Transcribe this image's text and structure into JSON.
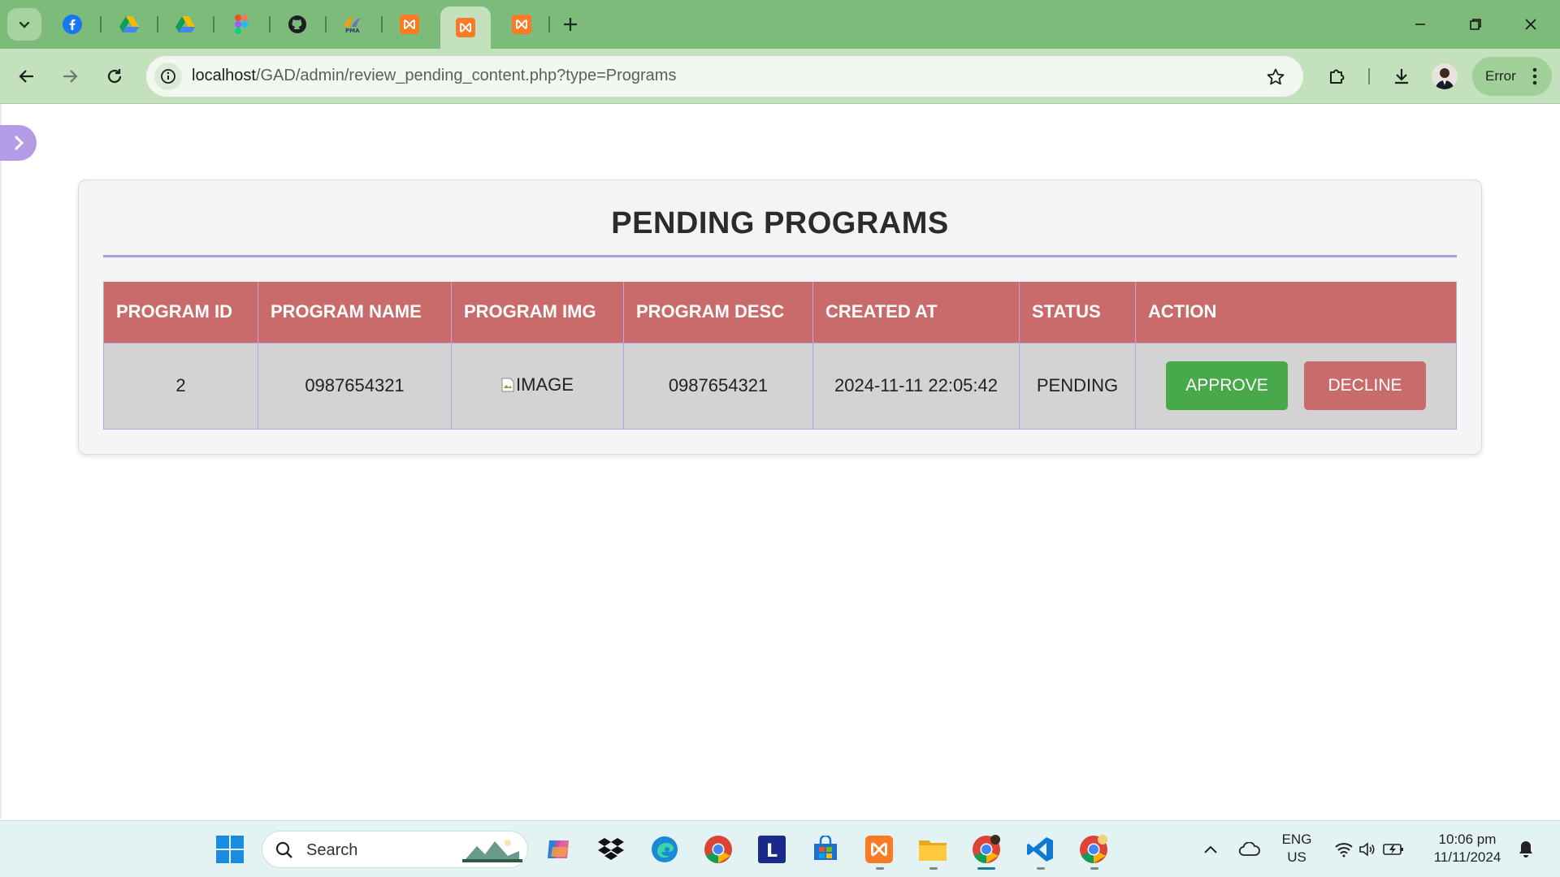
{
  "browser": {
    "pinned_tabs": [
      "facebook-icon",
      "google-drive-icon",
      "google-drive-icon",
      "figma-icon",
      "github-icon",
      "phpmyadmin-icon",
      "xampp-icon"
    ],
    "active_tab": "xampp-icon",
    "extra_tabs": [
      "xampp-icon"
    ],
    "url_host": "localhost",
    "url_path": "/GAD/admin/review_pending_content.php?type=Programs",
    "profile_status": "Error"
  },
  "page": {
    "title": "PENDING PROGRAMS",
    "columns": [
      "PROGRAM ID",
      "PROGRAM NAME",
      "PROGRAM IMG",
      "PROGRAM DESC",
      "CREATED AT",
      "STATUS",
      "ACTION"
    ],
    "rows": [
      {
        "id": "2",
        "name": "0987654321",
        "img_alt": "IMAGE",
        "desc": "0987654321",
        "created_at": "2024-11-11 22:05:42",
        "status": "PENDING",
        "approve_label": "APPROVE",
        "decline_label": "DECLINE"
      }
    ]
  },
  "taskbar": {
    "search_placeholder": "Search",
    "lang_line1": "ENG",
    "lang_line2": "US",
    "time": "10:06 pm",
    "date": "11/11/2024"
  },
  "colors": {
    "chrome_green": "#7dbb7a",
    "accent_purple": "#b49be6",
    "header_red": "#c96b6b",
    "approve_green": "#48a94a"
  }
}
